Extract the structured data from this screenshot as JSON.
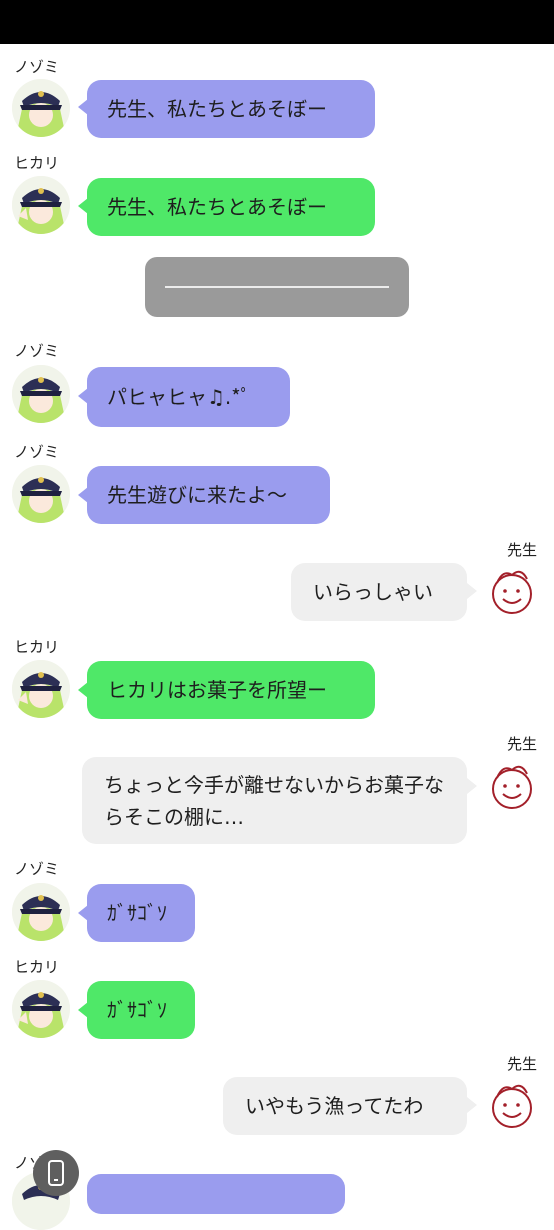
{
  "colors": {
    "nozomi": "#9a9cee",
    "hikari": "#4fe868",
    "sensei": "#efefef",
    "divider": "#9a9a9a"
  },
  "messages": [
    {
      "sender": "ノゾミ",
      "text": "先生、私たちとあそぼー"
    },
    {
      "sender": "ヒカリ",
      "text": "先生、私たちとあそぼー"
    },
    {
      "sender": "ノゾミ",
      "text": "パヒャヒャ♫.*ﾟ"
    },
    {
      "sender": "ノゾミ",
      "text": "先生遊びに来たよ〜"
    },
    {
      "sender": "先生",
      "text": "いらっしゃい"
    },
    {
      "sender": "ヒカリ",
      "text": "ヒカリはお菓子を所望ー"
    },
    {
      "sender": "先生",
      "text": "ちょっと今手が離せないからお菓子ならそこの棚に…"
    },
    {
      "sender": "ノゾミ",
      "text": "ｶﾞｻｺﾞｿ"
    },
    {
      "sender": "ヒカリ",
      "text": "ｶﾞｻｺﾞｿ"
    },
    {
      "sender": "先生",
      "text": "いやもう漁ってたわ"
    }
  ],
  "partial_sender": "ノゾ"
}
